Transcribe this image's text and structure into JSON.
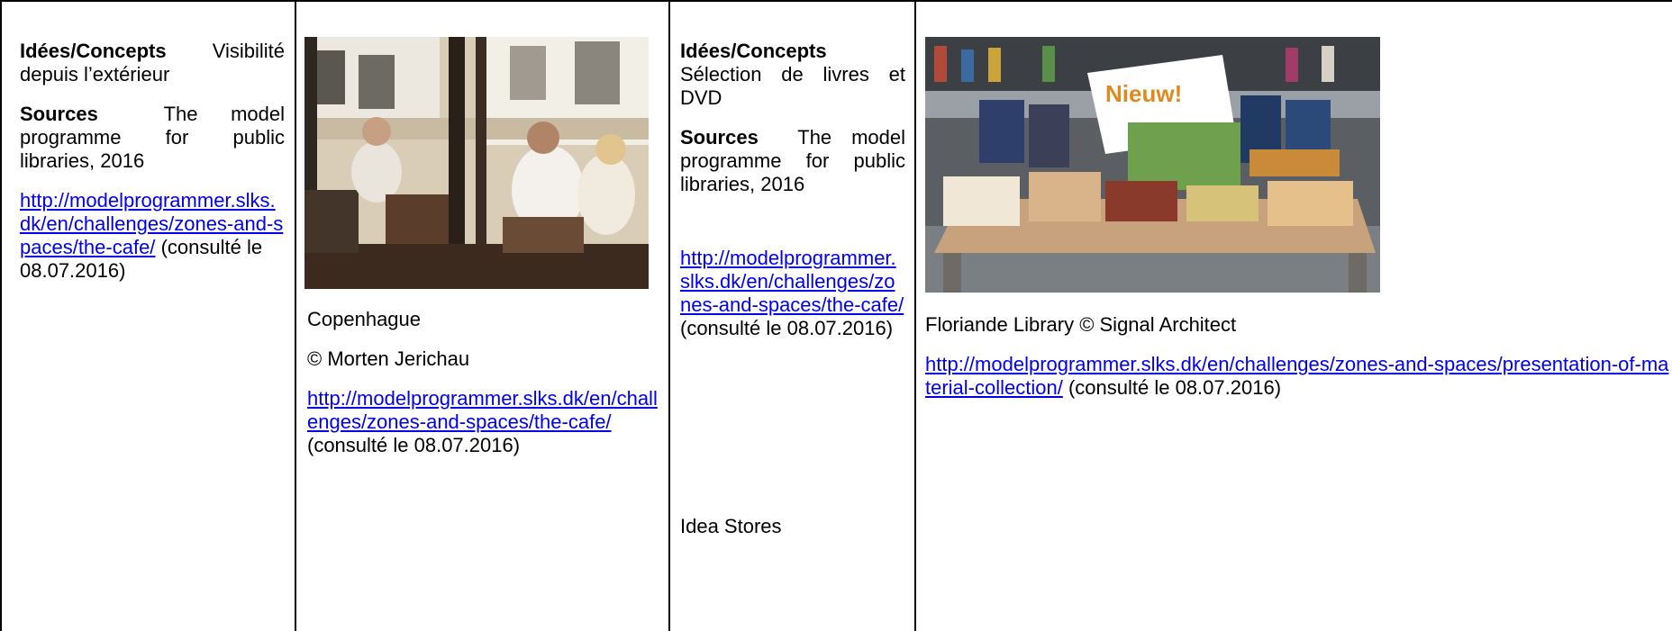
{
  "col1": {
    "ideas_label": "Idées/Concepts",
    "ideas_text": "Visibilité depuis l’extérieur",
    "sources_label": "Sources",
    "sources_text": "The model programme for public libraries, 2016",
    "link": "http://modelprogrammer.slks.dk/en/challenges/zones-and-spaces/the-cafe/",
    "consulted": "(consulté le 08.07.2016)"
  },
  "col2": {
    "photo": "cafe-photo",
    "caption": "Copenhague",
    "credit": "© Morten Jerichau",
    "link": "http://modelprogrammer.slks.dk/en/challenges/zones-and-spaces/the-cafe/",
    "consulted": "(consulté le 08.07.2016)"
  },
  "col3": {
    "ideas_label": "Idées/Concepts",
    "ideas_text": "Sélection de livres et DVD",
    "sources_label": "Sources",
    "sources_text": "The model programme for public libraries, 2016",
    "link": "http://modelprogrammer.slks.dk/en/challenges/zones-and-spaces/the-cafe/",
    "consulted": "(consulté le 08.07.2016)",
    "footer": "Idea Stores"
  },
  "col4": {
    "photo": "books-table-photo",
    "photo_sign": "Nieuw!",
    "caption": "Floriande Library © Signal Architect",
    "link": "http://modelprogrammer.slks.dk/en/challenges/zones-and-spaces/presentation-of-material-collection/",
    "consulted": "(consulté le 08.07.2016)"
  },
  "colors": {
    "link": "#0000ee",
    "border": "#000000"
  }
}
